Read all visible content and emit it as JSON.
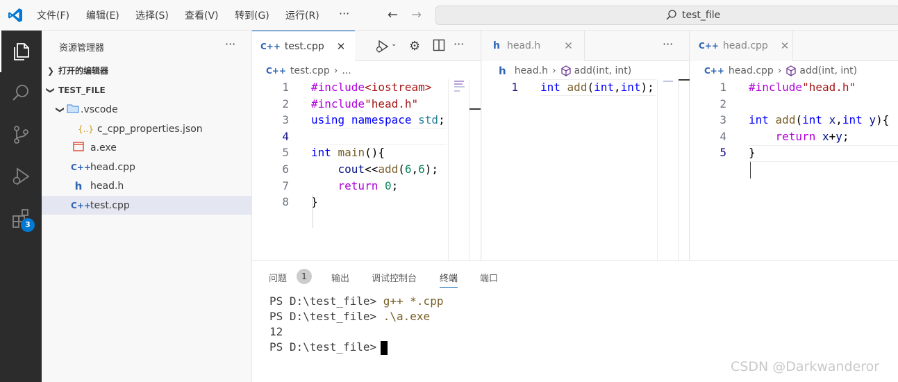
{
  "titlebar": {
    "menus": [
      "文件(F)",
      "编辑(E)",
      "选择(S)",
      "查看(V)",
      "转到(G)",
      "运行(R)"
    ],
    "more": "···",
    "back_icon": "arrow-left-icon",
    "forward_icon": "arrow-right-icon",
    "search_text": "test_file"
  },
  "activitybar": {
    "icons": [
      "explorer-icon",
      "search-icon",
      "source-control-icon",
      "run-debug-icon",
      "extensions-icon"
    ],
    "extensions_badge": "3"
  },
  "sidebar": {
    "title": "资源管理器",
    "more": "···",
    "open_editors": "打开的编辑器",
    "workspace": "TEST_FILE",
    "items": [
      {
        "label": ".vscode",
        "kind": "folder"
      },
      {
        "label": "c_cpp_properties.json",
        "kind": "json"
      },
      {
        "label": "a.exe",
        "kind": "exe"
      },
      {
        "label": "head.cpp",
        "kind": "cpp"
      },
      {
        "label": "head.h",
        "kind": "h"
      },
      {
        "label": "test.cpp",
        "kind": "cpp"
      }
    ]
  },
  "editors": {
    "group1": {
      "tab": "test.cpp",
      "breadcrumb_file": "test.cpp",
      "breadcrumb_rest": "...",
      "line_numbers": [
        "1",
        "2",
        "3",
        "4",
        "5",
        "6",
        "7",
        "8"
      ],
      "lines": [
        [
          [
            "pp",
            "#include"
          ],
          [
            "str",
            "<iostream>"
          ]
        ],
        [
          [
            "pp",
            "#include"
          ],
          [
            "str",
            "\"head.h\""
          ]
        ],
        [
          [
            "kw",
            "using"
          ],
          [
            "plain",
            " "
          ],
          [
            "kw",
            "namespace"
          ],
          [
            "plain",
            " "
          ],
          [
            "type",
            "std"
          ],
          [
            "plain",
            ";"
          ]
        ],
        [],
        [
          [
            "kw",
            "int"
          ],
          [
            "plain",
            " "
          ],
          [
            "fn",
            "main"
          ],
          [
            "plain",
            "(){"
          ]
        ],
        [
          [
            "plain",
            "    "
          ],
          [
            "var",
            "cout"
          ],
          [
            "plain",
            "<<"
          ],
          [
            "fn",
            "add"
          ],
          [
            "plain",
            "("
          ],
          [
            "num",
            "6"
          ],
          [
            "plain",
            ","
          ],
          [
            "num",
            "6"
          ],
          [
            "plain",
            ");"
          ]
        ],
        [
          [
            "plain",
            "    "
          ],
          [
            "ctrl",
            "return"
          ],
          [
            "plain",
            " "
          ],
          [
            "num",
            "0"
          ],
          [
            "plain",
            ";"
          ]
        ],
        [
          [
            "plain",
            "}"
          ]
        ]
      ]
    },
    "group2": {
      "tab": "head.h",
      "breadcrumb_file": "head.h",
      "breadcrumb_symbol": "add(int, int)",
      "line_numbers": [
        "1"
      ],
      "lines": [
        [
          [
            "kw",
            "int"
          ],
          [
            "plain",
            " "
          ],
          [
            "fn",
            "add"
          ],
          [
            "plain",
            "("
          ],
          [
            "kw",
            "int"
          ],
          [
            "plain",
            ","
          ],
          [
            "kw",
            "int"
          ],
          [
            "plain",
            ");"
          ]
        ]
      ]
    },
    "group3": {
      "tab": "head.cpp",
      "breadcrumb_file": "head.cpp",
      "breadcrumb_symbol": "add(int, int)",
      "line_numbers": [
        "1",
        "2",
        "3",
        "4",
        "5"
      ],
      "lines": [
        [
          [
            "pp",
            "#include"
          ],
          [
            "str",
            "\"head.h\""
          ]
        ],
        [],
        [
          [
            "kw",
            "int"
          ],
          [
            "plain",
            " "
          ],
          [
            "fn",
            "add"
          ],
          [
            "plain",
            "("
          ],
          [
            "kw",
            "int"
          ],
          [
            "plain",
            " "
          ],
          [
            "var",
            "x"
          ],
          [
            "plain",
            ","
          ],
          [
            "kw",
            "int"
          ],
          [
            "plain",
            " "
          ],
          [
            "var",
            "y"
          ],
          [
            "plain",
            "){"
          ]
        ],
        [
          [
            "plain",
            "    "
          ],
          [
            "ctrl",
            "return"
          ],
          [
            "plain",
            " "
          ],
          [
            "var",
            "x"
          ],
          [
            "plain",
            "+"
          ],
          [
            "var",
            "y"
          ],
          [
            "plain",
            ";"
          ]
        ],
        [
          [
            "plain",
            "}"
          ]
        ]
      ]
    }
  },
  "panel": {
    "tabs": [
      "问题",
      "输出",
      "调试控制台",
      "终端",
      "端口"
    ],
    "problems_count": "1",
    "active_tab": "终端",
    "terminal": [
      {
        "prompt": "PS D:\\test_file>",
        "cmd": " g++ *.cpp"
      },
      {
        "prompt": "PS D:\\test_file>",
        "cmd": " .\\a.exe"
      },
      {
        "prompt": "12",
        "cmd": ""
      },
      {
        "prompt": "PS D:\\test_file>",
        "cmd": ""
      }
    ]
  },
  "watermark": "CSDN @Darkwanderor"
}
